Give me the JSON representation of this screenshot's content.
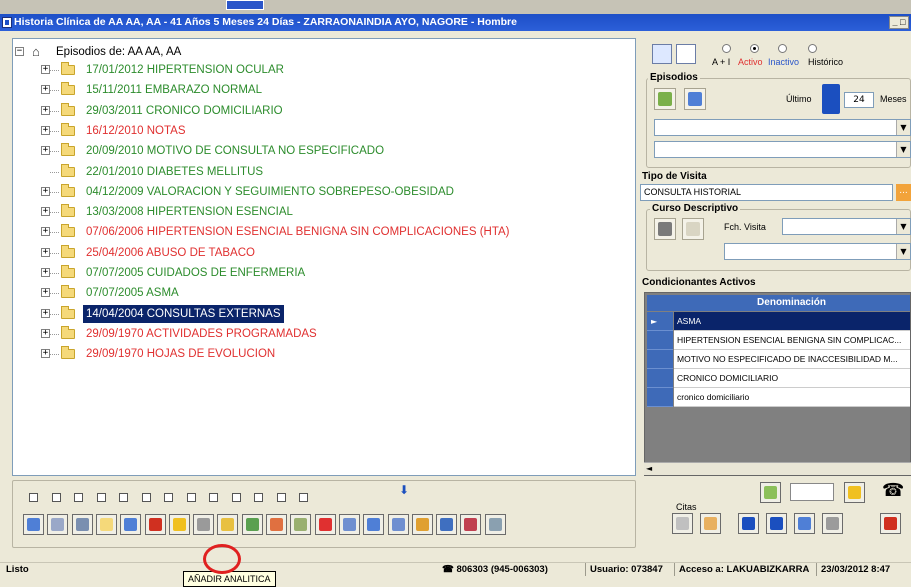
{
  "window": {
    "title": "Historia Clínica de AA AA, AA  - 41 Años 5 Meses 24 Días - ZARRAONAINDIA AYO, NAGORE - Hombre",
    "controls": "_ □"
  },
  "tree": {
    "root_label": "Episodios de: AA AA, AA",
    "nodes": [
      {
        "label": "17/01/2012  HIPERTENSION OCULAR",
        "color": "green"
      },
      {
        "label": "15/11/2011  EMBARAZO NORMAL",
        "color": "green"
      },
      {
        "label": "29/03/2011  CRONICO DOMICILIARIO",
        "color": "green"
      },
      {
        "label": "16/12/2010  NOTAS",
        "color": "red"
      },
      {
        "label": "20/09/2010  MOTIVO DE CONSULTA NO ESPECIFICADO",
        "color": "green"
      },
      {
        "label": "22/01/2010  DIABETES MELLITUS",
        "color": "green"
      },
      {
        "label": "04/12/2009  VALORACION Y SEGUIMIENTO SOBREPESO-OBESIDAD",
        "color": "green"
      },
      {
        "label": "13/03/2008  HIPERTENSION ESENCIAL",
        "color": "green"
      },
      {
        "label": "07/06/2006  HIPERTENSION ESENCIAL BENIGNA SIN COMPLICACIONES (HTA)",
        "color": "red"
      },
      {
        "label": "25/04/2006  ABUSO DE TABACO",
        "color": "red"
      },
      {
        "label": "07/07/2005  CUIDADOS DE ENFERMERIA",
        "color": "green"
      },
      {
        "label": "07/07/2005  ASMA",
        "color": "green"
      },
      {
        "label": "14/04/2004  CONSULTAS EXTERNAS",
        "color": "selected"
      },
      {
        "label": "29/09/1970  ACTIVIDADES PROGRAMADAS",
        "color": "red"
      },
      {
        "label": "29/09/1970  HOJAS DE EVOLUCION",
        "color": "red"
      }
    ]
  },
  "filters": {
    "radio_labels": [
      "A + I",
      "Activo",
      "Inactivo",
      "Histórico"
    ],
    "selected": "Activo"
  },
  "episodios": {
    "title": "Episodios",
    "ultimo_label": "Último",
    "ultimo_value": "24",
    "meses_label": "Meses"
  },
  "tipo_visita": {
    "title": "Tipo de Visita",
    "value": "CONSULTA HISTORIAL",
    "browse_label": "..."
  },
  "curso": {
    "title": "Curso Descriptivo",
    "fch_label": "Fch. Visita"
  },
  "condicionantes": {
    "title": "Condicionantes Activos",
    "column": "Denominación",
    "rows": [
      "ASMA",
      "HIPERTENSION ESENCIAL BENIGNA SIN COMPLICAC...",
      "MOTIVO NO ESPECIFICADO DE INACCESIBILIDAD M...",
      "CRONICO DOMICILIARIO",
      "cronico domiciliario"
    ]
  },
  "citas_label": "Citas",
  "tooltip": "AÑADIR ANALITICA",
  "status": {
    "left": "Listo",
    "phone": "806303 (945-006303)",
    "user": "Usuario: 073847",
    "access": "Acceso a: LAKUABIZKARRA",
    "datetime": "23/03/2012  8:47"
  },
  "colors": {
    "green": "#2c8c2c",
    "red": "#e03030",
    "selection": "#0a246a",
    "title_bar": "#1d4fc7"
  }
}
